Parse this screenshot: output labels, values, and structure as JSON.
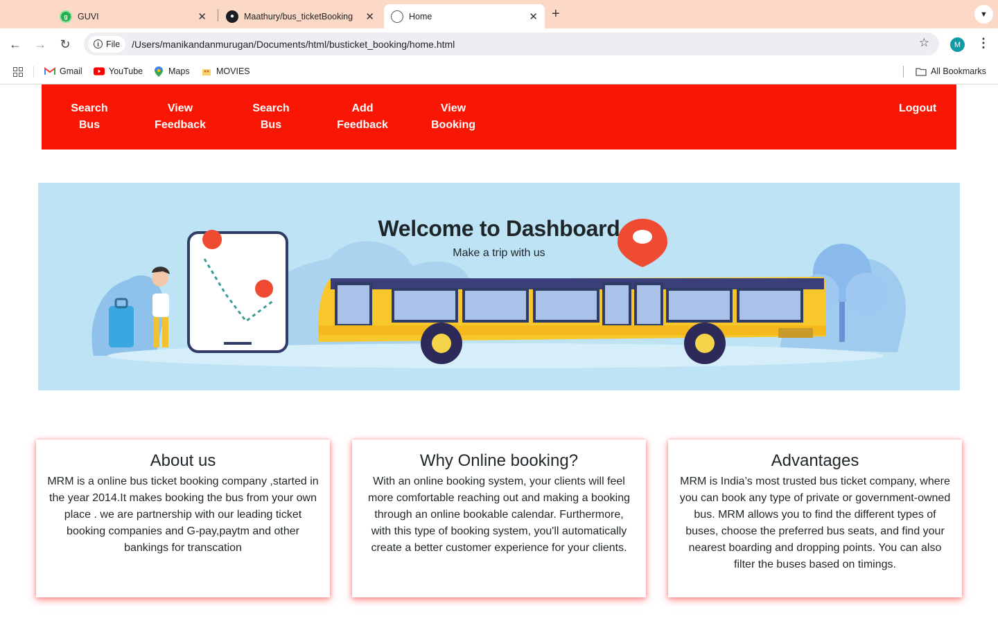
{
  "browser": {
    "tabs": [
      {
        "title": "GUVI",
        "icon": "guvi-favicon",
        "active": false
      },
      {
        "title": "Maathury/bus_ticketBooking",
        "icon": "github-favicon",
        "active": false
      },
      {
        "title": "Home",
        "icon": "globe-favicon",
        "active": true
      }
    ],
    "new_tab": "+",
    "address": {
      "chip_label": "File",
      "url": "/Users/manikandanmurugan/Documents/html/busticket_booking/home.html"
    },
    "profile_initial": "M",
    "bookmarks": [
      {
        "label": "Gmail",
        "icon": "gmail-icon"
      },
      {
        "label": "YouTube",
        "icon": "youtube-icon"
      },
      {
        "label": "Maps",
        "icon": "maps-icon"
      },
      {
        "label": "MOVIES",
        "icon": "folder-movies-icon"
      }
    ],
    "all_bookmarks": "All Bookmarks"
  },
  "nav": {
    "items": [
      {
        "line1": "Search",
        "line2": "Bus"
      },
      {
        "line1": "View",
        "line2": "Feedback"
      },
      {
        "line1": "Search",
        "line2": "Bus"
      },
      {
        "line1": "Add",
        "line2": "Feedback"
      },
      {
        "line1": "View",
        "line2": "Booking"
      }
    ],
    "logout": "Logout",
    "color": "#fa1605"
  },
  "hero": {
    "title": "Welcome to Dashboard",
    "subtitle": "Make a trip with us",
    "background": "#bde3f4"
  },
  "cards": [
    {
      "title": "About us",
      "body": "MRM is a online bus ticket booking company ,started in the year 2014.It makes booking the bus from your own place . we are partnership with our leading ticket booking companies and G-pay,paytm and other bankings for transcation"
    },
    {
      "title": "Why Online booking?",
      "body": "With an online booking system, your clients will feel more comfortable reaching out and making a booking through an online bookable calendar. Furthermore, with this type of booking system, you'll automatically create a better customer experience for your clients."
    },
    {
      "title": "Advantages",
      "body": "MRM is India’s most trusted bus ticket company, where you can book any type of private or government-owned bus. MRM allows you to find the different types of buses, choose the preferred bus seats, and find your nearest boarding and dropping points. You can also filter the buses based on timings."
    }
  ]
}
